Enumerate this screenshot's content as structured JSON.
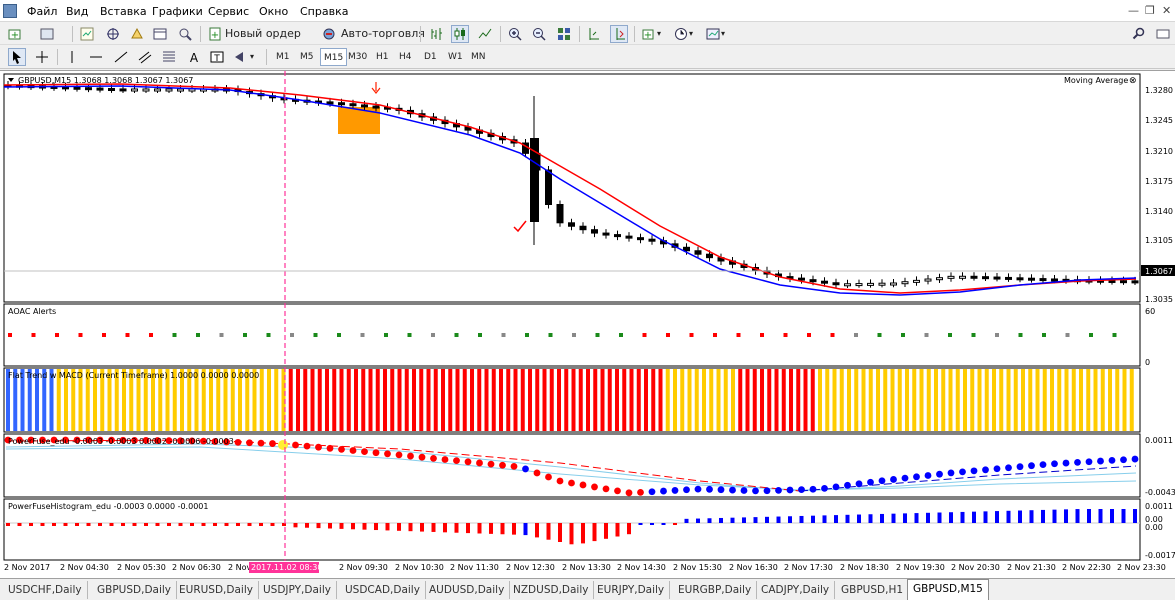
{
  "menu": {
    "items": [
      "Файл",
      "Вид",
      "Вставка",
      "Графики",
      "Сервис",
      "Окно",
      "Справка"
    ]
  },
  "toolbar": {
    "new_order": "Новый ордер",
    "auto_trading": "Авто-торговля"
  },
  "timeframes": [
    "M1",
    "M5",
    "M15",
    "M30",
    "H1",
    "H4",
    "D1",
    "W1",
    "MN"
  ],
  "timeframe_selected": "M15",
  "chart": {
    "info": "GBPUSD,M15  1.3068 1.3068 1.3067 1.3067",
    "indicator_label": "Moving Average",
    "price_ticks": [
      "1.3280",
      "1.3245",
      "1.3210",
      "1.3175",
      "1.3140",
      "1.3105",
      "1.3067",
      "1.3035"
    ],
    "current_price": "1.3067",
    "vline_label": "2017.11.02 08:30",
    "time_labels": [
      "2 Nov 2017",
      "2 Nov 04:30",
      "2 Nov 05:30",
      "2 Nov 06:30",
      "2 Nov 07:30",
      "2 Nov 09:30",
      "2 Nov 10:30",
      "2 Nov 11:30",
      "2 Nov 12:30",
      "2 Nov 13:30",
      "2 Nov 14:30",
      "2 Nov 15:30",
      "2 Nov 16:30",
      "2 Nov 17:30",
      "2 Nov 18:30",
      "2 Nov 19:30",
      "2 Nov 20:30",
      "2 Nov 21:30",
      "2 Nov 22:30",
      "2 Nov 23:30"
    ],
    "colors": {
      "ma_fast": "#0000ff",
      "ma_slow": "#ff0000",
      "bull": "#ffffff",
      "bear": "#000000",
      "vline": "#ff3399",
      "highlight": "#ff9900"
    }
  },
  "panels": {
    "aoac": {
      "label": "AOAC Alerts",
      "scale_top": "60",
      "scale_bottom": "0"
    },
    "flat": {
      "label": "Flat Trend w MACD (Current Timeframe) 1.0000 0.0000 0.0000"
    },
    "power": {
      "label": "PowerFuse_edu -0.0003 -0.0003 0.0002 -0.0006 -0.0003",
      "scale_top": "0.0011",
      "scale_bottom": "-0.0043"
    },
    "hist": {
      "label": "PowerFuseHistogram_edu -0.0003 0.0000 -0.0001",
      "scale_top": "0.0011",
      "scale_mid1": "0.00",
      "scale_mid2": "0.00",
      "scale_bottom": "-0.0017"
    }
  },
  "tabs": [
    "USDCHF,Daily",
    "GBPUSD,Daily",
    "EURUSD,Daily",
    "USDJPY,Daily",
    "USDCAD,Daily",
    "AUDUSD,Daily",
    "NZDUSD,Daily",
    "EURJPY,Daily",
    "EURGBP,Daily",
    "CADJPY,Daily",
    "GBPUSD,H1",
    "GBPUSD,M15"
  ],
  "active_tab": "GBPUSD,M15"
}
